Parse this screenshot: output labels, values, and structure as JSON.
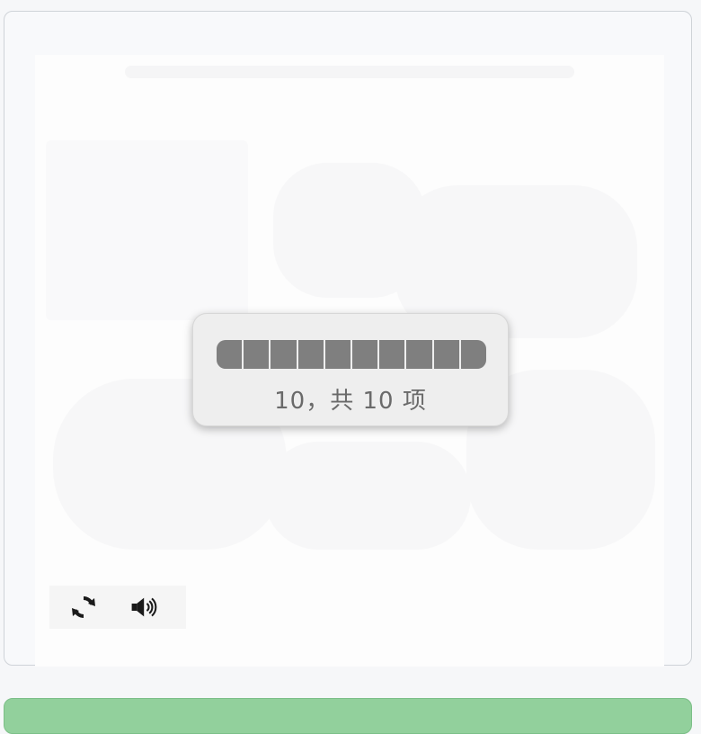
{
  "progress": {
    "label": "10，共 10 项",
    "current": 10,
    "total": 10,
    "fraction": 1.0
  },
  "controls": {
    "refresh_icon": "refresh-icon",
    "audio_icon": "speaker-icon"
  },
  "colors": {
    "progress_fill": "#7f7f7f",
    "popup_background": "#eeeeee",
    "bottom_bar": "#92d09c"
  }
}
